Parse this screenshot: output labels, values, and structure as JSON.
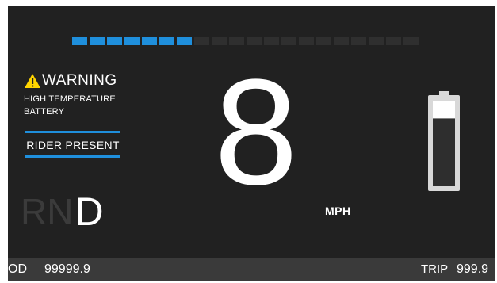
{
  "gauge": {
    "total_segments": 20,
    "active_segments": 7,
    "active_color": "#1f8fdc",
    "inactive_color": "#2f2f2f"
  },
  "warning": {
    "icon": "warning-triangle-icon",
    "title": "WARNING",
    "line1": "HIGH TEMPERATURE",
    "line2": "BATTERY"
  },
  "rider": {
    "label": "RIDER PRESENT"
  },
  "gears": {
    "items": [
      "R",
      "N",
      "D"
    ],
    "active": "D"
  },
  "speed": {
    "value": "8",
    "unit": "MPH"
  },
  "battery": {
    "icon": "battery-icon",
    "level": 0.8
  },
  "odometer": {
    "label": "OD",
    "value": "99999.9"
  },
  "trip": {
    "label": "TRIP",
    "value": "999.9"
  },
  "colors": {
    "background": "#212121",
    "accent": "#1f8fdc",
    "warning": "#ffd400",
    "bottom_bar": "#3a3a3a"
  }
}
